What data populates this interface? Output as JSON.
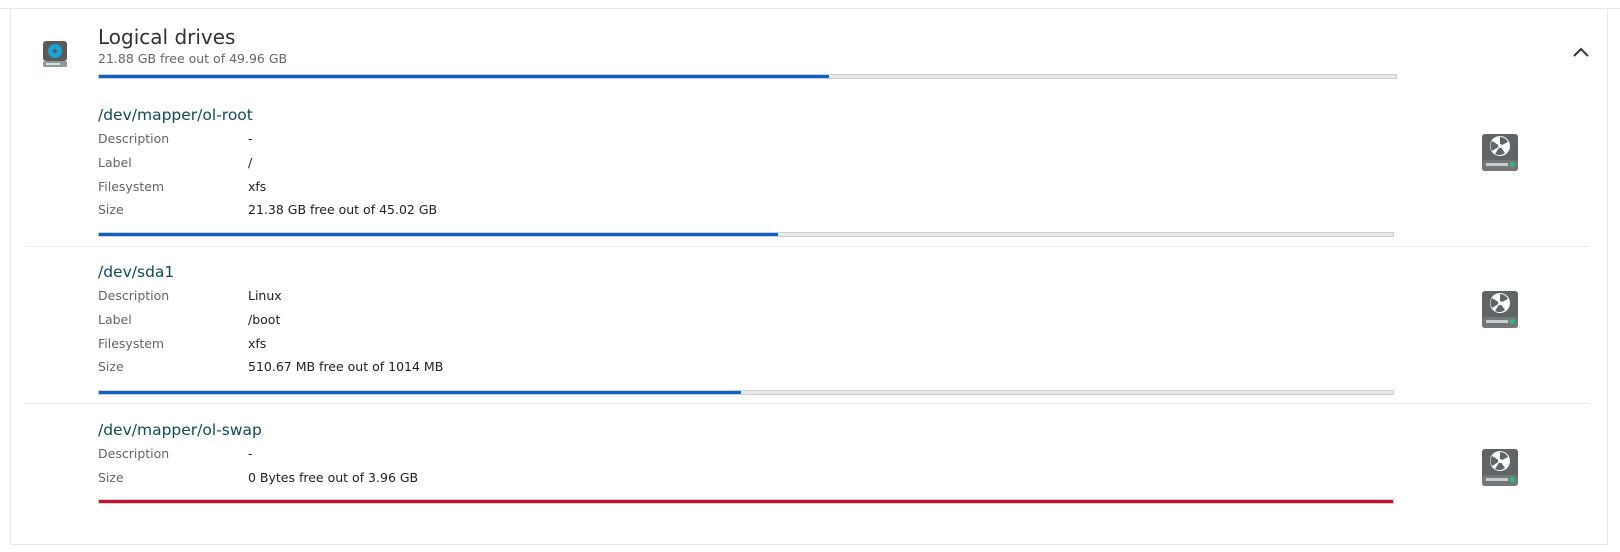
{
  "section": {
    "title": "Logical drives",
    "summary": "21.88 GB free out of 49.96 GB",
    "used_fraction": 0.563,
    "icons": {
      "header": "drive-icon",
      "collapse": "chevron-up-icon"
    }
  },
  "drives": [
    {
      "name": "/dev/mapper/ol-root",
      "rows": [
        {
          "key": "Description",
          "value": "-"
        },
        {
          "key": "Label",
          "value": "/"
        },
        {
          "key": "Filesystem",
          "value": "xfs"
        },
        {
          "key": "Size",
          "value": "21.38 GB free out of 45.02 GB"
        }
      ],
      "used_fraction": 0.525,
      "icon": "hard-drive-icon"
    },
    {
      "name": "/dev/sda1",
      "rows": [
        {
          "key": "Description",
          "value": "Linux"
        },
        {
          "key": "Label",
          "value": "/boot"
        },
        {
          "key": "Filesystem",
          "value": "xfs"
        },
        {
          "key": "Size",
          "value": "510.67 MB free out of 1014 MB"
        }
      ],
      "used_fraction": 0.496,
      "icon": "hard-drive-icon"
    },
    {
      "name": "/dev/mapper/ol-swap",
      "rows": [
        {
          "key": "Description",
          "value": "-"
        },
        {
          "key": "Size",
          "value": "0 Bytes free out of 3.96 GB"
        }
      ],
      "used_fraction": 1.0,
      "icon": "hard-drive-icon"
    }
  ],
  "colors": {
    "used": "#0b62c4",
    "full": "#c8102e",
    "track": "#e9e9e9",
    "drive_name": "#0f4c56"
  }
}
